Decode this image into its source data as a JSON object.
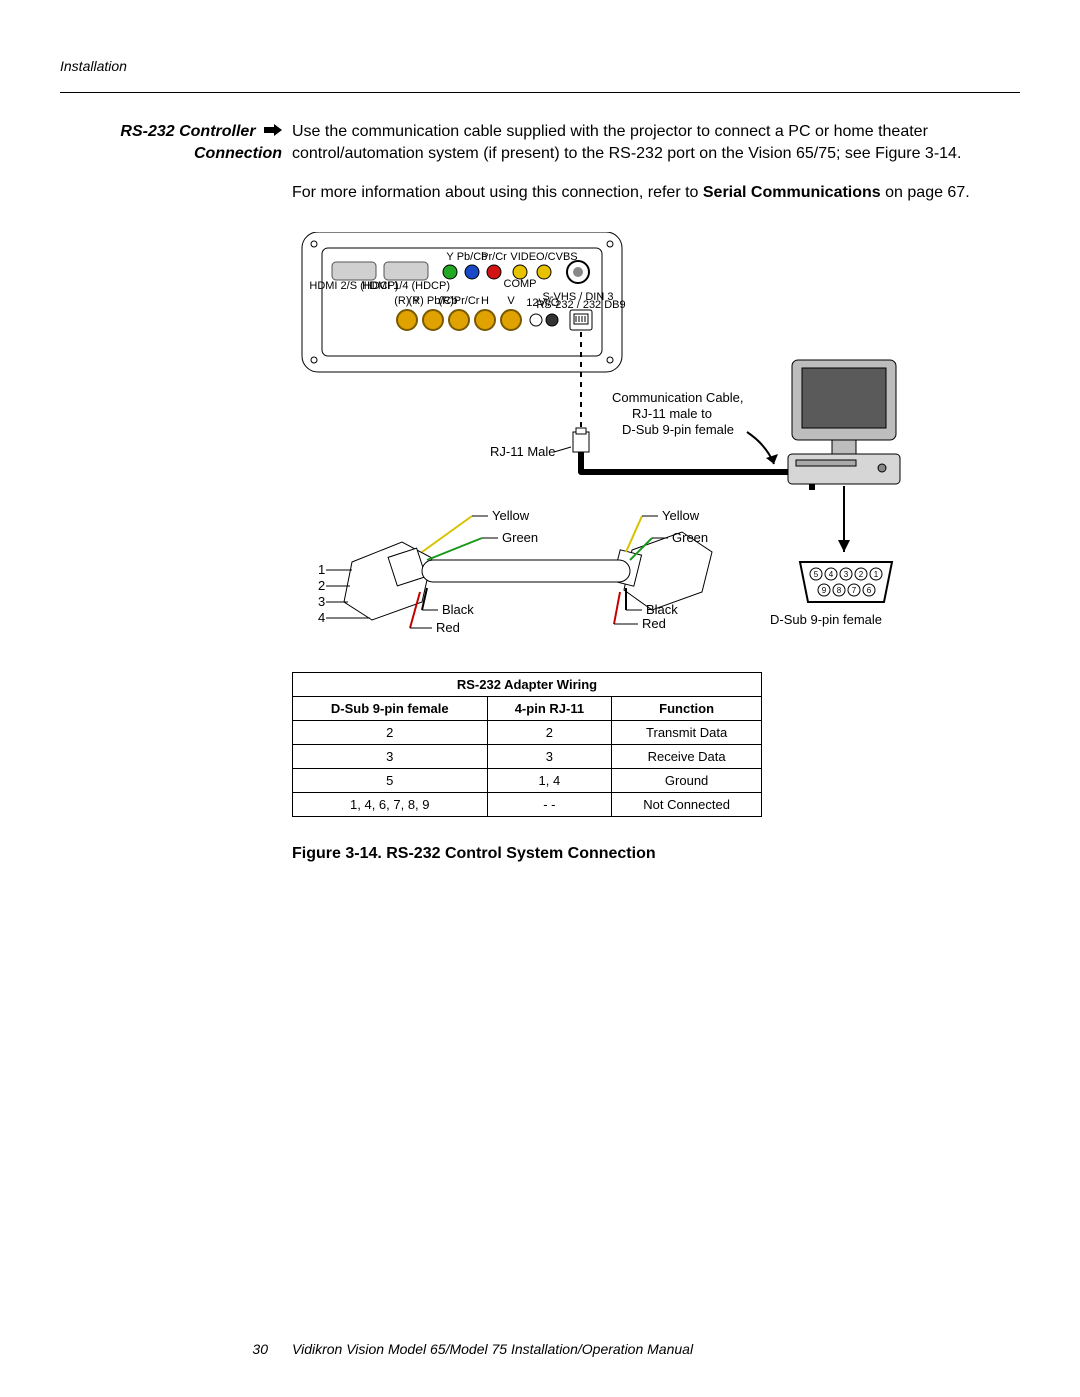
{
  "header": {
    "section": "Installation"
  },
  "side_heading": {
    "line1": "RS-232 Controller",
    "line2": "Connection"
  },
  "body": {
    "p1_a": "Use the communication cable supplied with the projector to connect a PC or home theater control/automation system (if present) to the RS-232 port on the Vision 65/75; see Figure 3-14.",
    "p2_pre": "For more information about using this connection, refer to ",
    "p2_bold": "Serial Communications",
    "p2_post": " on page 67."
  },
  "diagram": {
    "comm_cable_l1": "Communication Cable,",
    "comm_cable_l2": "RJ-11 male to",
    "comm_cable_l3": "D-Sub 9-pin female",
    "rj11_male": "RJ-11 Male",
    "yellow": "Yellow",
    "green": "Green",
    "black": "Black",
    "red": "Red",
    "pin1": "1",
    "pin2": "2",
    "pin3": "3",
    "pin4": "4",
    "dsub_female": "D-Sub 9-pin female",
    "dsub_pins": [
      "5",
      "4",
      "3",
      "2",
      "1",
      "9",
      "8",
      "7",
      "6"
    ],
    "panel_labels": {
      "hdmi2": "HDMI 2/S (HDCP)",
      "hdmi1": "HDMI 1/4 (HDCP)",
      "y": "Y",
      "pbcb": "Pb/Cb",
      "prcr": "Pr/Cr",
      "comp": "COMP",
      "video": "VIDEO/CVBS",
      "row2_a": "(R) Y",
      "row2_b": "(R) Pb/Cb",
      "row2_c": "(R)Pr/Cr",
      "row2_h": "H",
      "row2_v": "V",
      "trig": "12V",
      "io": "I/O",
      "svhs": "S-VHS / DIN 3",
      "rs232": "RS-232 / 232 DB9"
    }
  },
  "table": {
    "title": "RS-232 Adapter Wiring",
    "headers": [
      "D-Sub 9-pin female",
      "4-pin RJ-11",
      "Function"
    ],
    "rows": [
      [
        "2",
        "2",
        "Transmit Data"
      ],
      [
        "3",
        "3",
        "Receive Data"
      ],
      [
        "5",
        "1, 4",
        "Ground"
      ],
      [
        "1, 4, 6, 7, 8, 9",
        "- -",
        "Not Connected"
      ]
    ]
  },
  "caption": "Figure 3-14. RS-232 Control System Connection",
  "footer": {
    "page": "30",
    "title": "Vidikron Vision Model 65/Model 75 Installation/Operation Manual"
  }
}
